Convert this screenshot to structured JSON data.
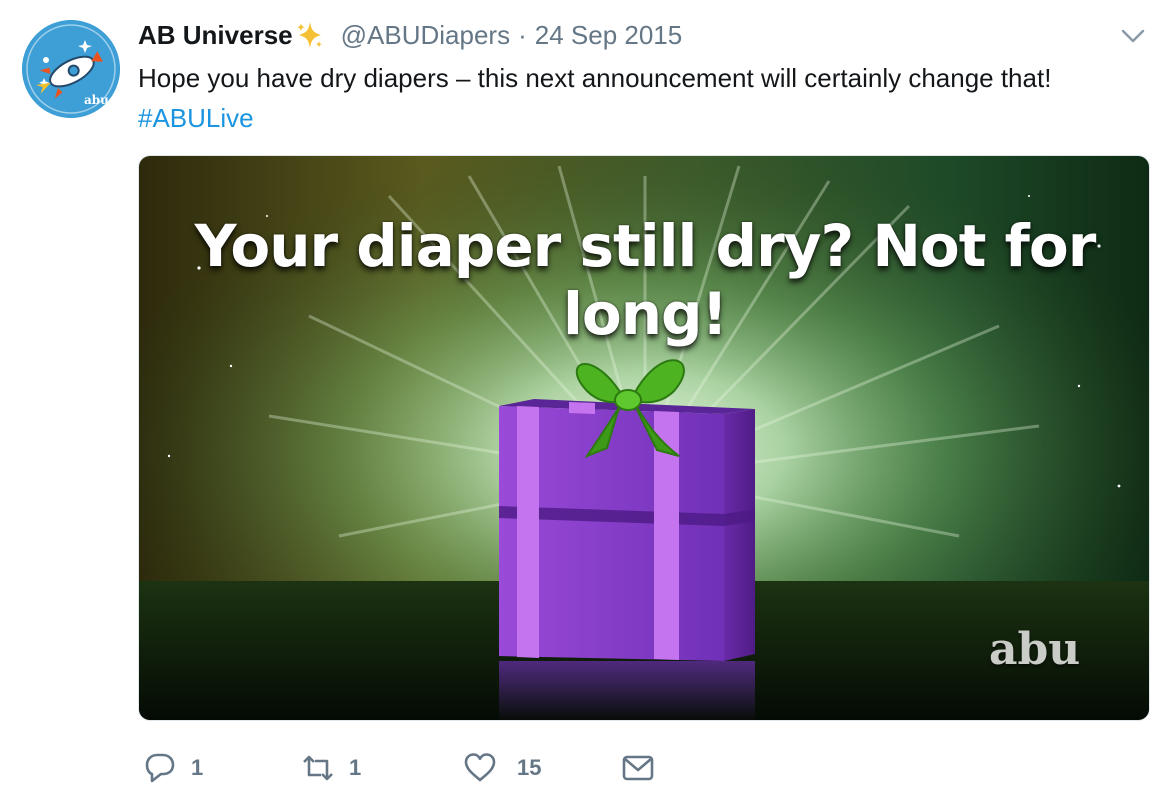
{
  "tweet": {
    "display_name": "AB Universe",
    "handle": "@ABUDiapers",
    "separator": "·",
    "date": "24 Sep 2015",
    "text": "Hope you have dry diapers – this next announcement will certainly change that!",
    "hashtag": "#ABULive"
  },
  "media": {
    "headline": "Your diaper still dry? Not for long!",
    "logo_text": "abu"
  },
  "actions": {
    "reply_count": "1",
    "retweet_count": "1",
    "like_count": "15"
  },
  "icons": {
    "verified_sparkle": "sparkles-icon",
    "more": "chevron-down-icon",
    "reply": "reply-icon",
    "retweet": "retweet-icon",
    "like": "heart-icon",
    "message": "envelope-icon"
  },
  "colors": {
    "text": "#14171a",
    "secondary": "#657786",
    "link": "#1b95e0",
    "avatar_bg": "#3d9fd6",
    "gift_purple": "#8a3fd0",
    "ribbon_green": "#3fa51c"
  }
}
